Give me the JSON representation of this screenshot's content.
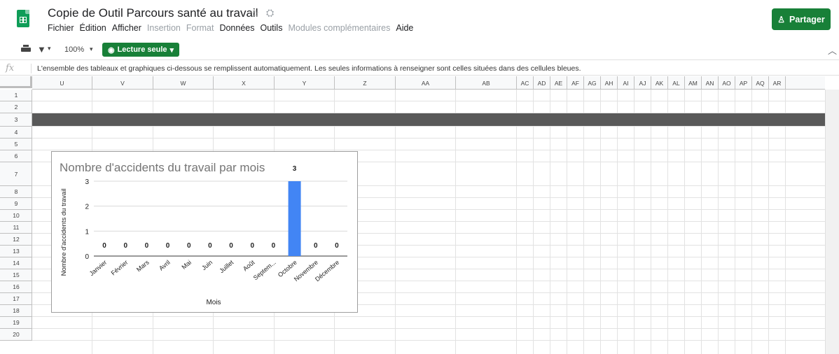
{
  "app": {
    "doc_title": "Copie de Outil Parcours santé au travail",
    "share_label": "Partager"
  },
  "menu": [
    {
      "label": "Fichier",
      "enabled": true
    },
    {
      "label": "Édition",
      "enabled": true
    },
    {
      "label": "Afficher",
      "enabled": true
    },
    {
      "label": "Insertion",
      "enabled": false
    },
    {
      "label": "Format",
      "enabled": false
    },
    {
      "label": "Données",
      "enabled": true
    },
    {
      "label": "Outils",
      "enabled": true
    },
    {
      "label": "Modules complémentaires",
      "enabled": false
    },
    {
      "label": "Aide",
      "enabled": true
    }
  ],
  "toolbar": {
    "zoom": "100%",
    "readonly_label": "Lecture seule"
  },
  "formula": {
    "fx": "fx",
    "text": "L'ensemble des tableaux et graphiques ci-dessous se remplissent automatiquement. Les seules informations à renseigner sont celles situées dans des cellules bleues."
  },
  "columns": [
    "U",
    "V",
    "W",
    "X",
    "Y",
    "Z",
    "AA",
    "AB",
    "AC",
    "AD",
    "AE",
    "AF",
    "AG",
    "AH",
    "AI",
    "AJ",
    "AK",
    "AL",
    "AM",
    "AN",
    "AO",
    "AP",
    "AQ",
    "AR"
  ],
  "rows": [
    "1",
    "2",
    "3",
    "4",
    "5",
    "6",
    "7",
    "8",
    "9",
    "10",
    "11",
    "12",
    "13",
    "14",
    "15",
    "16",
    "17",
    "18",
    "19",
    "20"
  ],
  "colors": {
    "brand_green": "#188038",
    "bar_blue": "#4285f4",
    "band_gray": "#595959"
  },
  "chart_data": {
    "type": "bar",
    "title": "Nombre d'accidents du travail par mois",
    "xlabel": "Mois",
    "ylabel": "Nombre d'accidents du travail",
    "categories": [
      "Janvier",
      "Février",
      "Mars",
      "Avril",
      "Mai",
      "Juin",
      "Juillet",
      "Août",
      "Septem...",
      "Octobre",
      "Novembre",
      "Décembre"
    ],
    "values": [
      0,
      0,
      0,
      0,
      0,
      0,
      0,
      0,
      0,
      3,
      0,
      0
    ],
    "data_labels": [
      "0",
      "0",
      "0",
      "0",
      "0",
      "0",
      "0",
      "0",
      "0",
      "3",
      "0",
      "0"
    ],
    "ylim": [
      0,
      3
    ],
    "yticks": [
      "0",
      "1",
      "2",
      "3"
    ],
    "grid": true,
    "legend": "none"
  }
}
